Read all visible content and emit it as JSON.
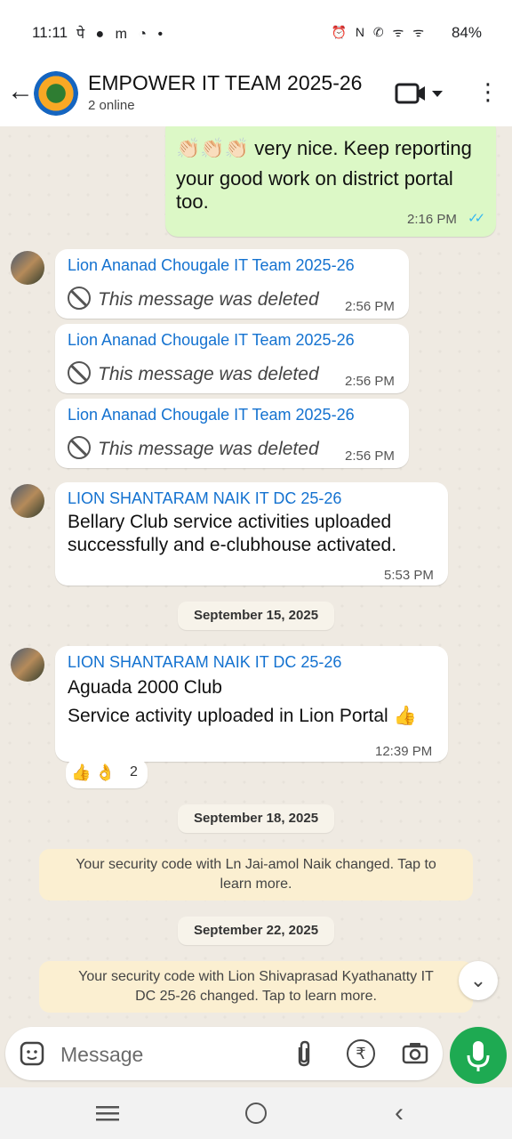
{
  "status_bar": {
    "time": "11:11",
    "left_icons": "पे ● m ◔ •",
    "right_icons": "⏰ N ✆ ᯤ ᯤ",
    "battery": "84%"
  },
  "header": {
    "title": "EMPOWER IT TEAM 2025-26",
    "subtitle": "2 online"
  },
  "messages": {
    "out_partial": {
      "text_line1": "👏🏻👏🏻👏🏻 very nice. Keep reporting",
      "text_line2": "your good work on district portal",
      "text_line3": "too.",
      "time": "2:16 PM",
      "ticks": "✓✓"
    },
    "deleted": [
      {
        "sender": "Lion Ananad Chougale IT Team 2025-26",
        "text": "This message was deleted",
        "time": "2:56 PM"
      },
      {
        "sender": "Lion Ananad Chougale IT Team 2025-26",
        "text": "This message was deleted",
        "time": "2:56 PM"
      },
      {
        "sender": "Lion Ananad Chougale IT Team 2025-26",
        "text": "This message was deleted",
        "time": "2:56 PM"
      }
    ],
    "bellary": {
      "sender": "LION SHANTARAM NAIK IT DC 25-26",
      "line1": "Bellary Club service activities uploaded",
      "line2": "successfully and e-clubhouse activated.",
      "time": "5:53 PM"
    },
    "date1": "September 15, 2025",
    "aguada": {
      "sender": "LION SHANTARAM NAIK IT DC 25-26",
      "line1": "Aguada 2000 Club",
      "line2": "Service activity uploaded in Lion Portal 👍",
      "time": "12:39 PM",
      "reactions": "👍 👌",
      "reaction_count": "2"
    },
    "date2": "September 18, 2025",
    "notice1_line1": "Your security code with Ln Jai-amol Naik changed. Tap to",
    "notice1_line2": "learn more.",
    "date3": "September 22, 2025",
    "notice2_line1": "Your security code with Lion Shivaprasad Kyathanatty IT",
    "notice2_line2": "DC 25-26 changed. Tap to learn more."
  },
  "composer": {
    "placeholder": "Message",
    "rupee_symbol": "₹"
  },
  "colors": {
    "accent_green": "#1eaa52",
    "sender_blue": "#1472d0",
    "outgoing_bubble": "#dcf8c6",
    "notice_bg": "#fbefd1"
  },
  "icons": {
    "back": "back-arrow-icon",
    "video": "video-call-icon",
    "menu": "more-vert-icon",
    "sticker": "sticker-icon",
    "attach": "paperclip-icon",
    "payment": "rupee-icon",
    "camera": "camera-icon",
    "mic": "microphone-icon",
    "scroll": "double-chevron-down-icon"
  }
}
